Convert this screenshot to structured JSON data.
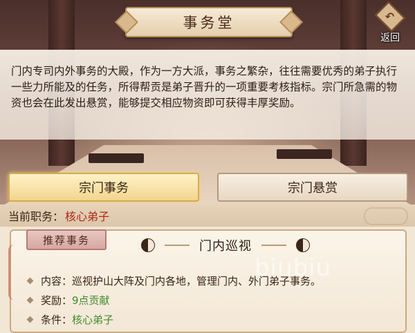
{
  "header": {
    "title": "事务堂",
    "back_label": "返回"
  },
  "description": "门内专司内外事务的大殿，作为一方大派，事务之繁杂，往往需要优秀的弟子执行一些力所能及的任务，所得帮贡是弟子晋升的一项重要考核指标。宗门所急需的物资也会在此发出悬赏，能够提交相应物资即可获得丰厚奖励。",
  "tabs": [
    {
      "label": "宗门事务",
      "active": true
    },
    {
      "label": "宗门悬赏",
      "active": false
    }
  ],
  "role": {
    "label": "当前职务：",
    "value": "核心弟子"
  },
  "task_card": {
    "tag": "推荐事务",
    "title": "门内巡视",
    "rows": [
      {
        "label": "内容：",
        "value": "巡视护山大阵及门内各地，管理门内、外门弟子事务。"
      },
      {
        "label": "奖励：",
        "value": "9点贡献"
      },
      {
        "label": "条件：",
        "value": "核心弟子"
      }
    ]
  },
  "watermark": "biubiu",
  "colors": {
    "active_tab": "#f1d58d",
    "role_value": "#b1261b",
    "green_value": "#3f8a2c"
  }
}
